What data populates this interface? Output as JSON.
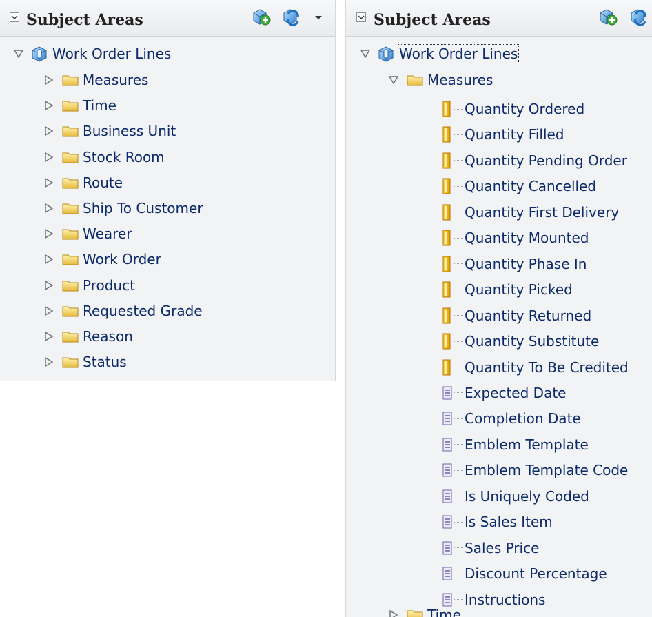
{
  "left_panel": {
    "header_title": "Subject Areas",
    "root_label": "Work Order Lines",
    "folders": [
      "Measures",
      "Time",
      "Business Unit",
      "Stock Room",
      "Route",
      "Ship To Customer",
      "Wearer",
      "Work Order",
      "Product",
      "Requested Grade",
      "Reason",
      "Status"
    ]
  },
  "right_panel": {
    "header_title": "Subject Areas",
    "root_label": "Work Order Lines",
    "expanded_folder": "Measures",
    "measures": [
      "Quantity Ordered",
      "Quantity Filled",
      "Quantity Pending Order",
      "Quantity Cancelled",
      "Quantity First Delivery",
      "Quantity Mounted",
      "Quantity Phase In",
      "Quantity Picked",
      "Quantity Returned",
      "Quantity Substitute",
      "Quantity To Be Credited"
    ],
    "attributes": [
      "Expected Date",
      "Completion Date",
      "Emblem Template",
      "Emblem Template Code",
      "Is Uniquely Coded",
      "Is Sales Item",
      "Sales Price",
      "Discount Percentage",
      "Instructions"
    ],
    "next_folder": "Time"
  },
  "icons": {
    "add_subject_area": "add-subject-area-icon",
    "refresh": "refresh-icon",
    "dropdown": "chevron-down-icon",
    "folder": "folder-icon",
    "measure": "measure-column-icon",
    "attribute": "attribute-column-icon",
    "subject_area": "subject-area-cube-icon"
  },
  "colors": {
    "text": "#0d2a6a",
    "folder": "#f2c94c",
    "measure": "#f0b400",
    "attribute": "#9b8fc8",
    "panel_bg": "#f2f3f5"
  }
}
